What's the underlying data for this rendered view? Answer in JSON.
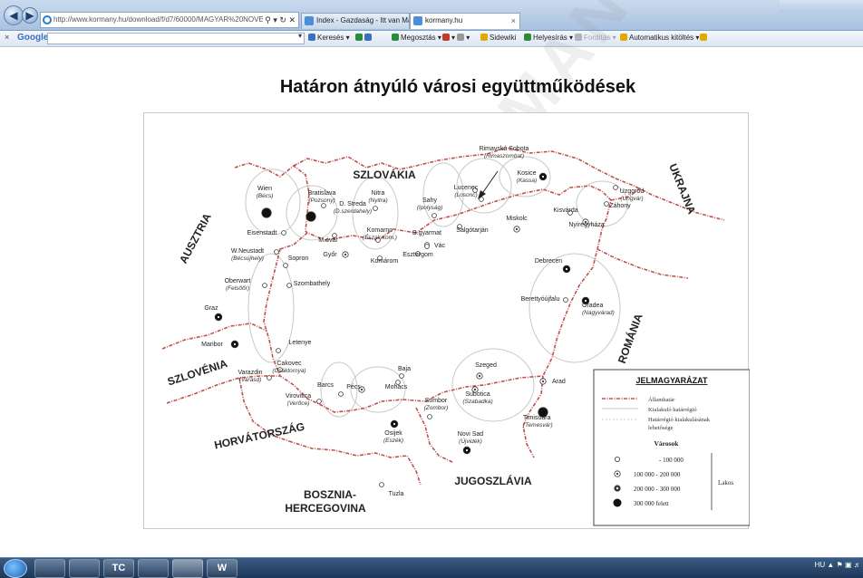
{
  "browser": {
    "address": "http://www.kormany.hu/download/f/d7/60000/MAGYAR%20NOVEKE",
    "tabs": [
      "Index - Gazdaság - Itt van Mat...",
      "kormany.hu"
    ],
    "tab_close": "×"
  },
  "googlebar": {
    "logo": "Google",
    "tools": [
      "Keresés ▾",
      "Megosztás ▾",
      "Sidewiki",
      "Helyesírás ▾",
      "Fordítás ▾",
      "Automatikus kitöltés ▾"
    ]
  },
  "page": {
    "title": "Határon átnyúló városi együttműködések",
    "watermark": "KORMANY"
  },
  "map": {
    "countries": [
      "SZLOVÁKIA",
      "UKRAJNA",
      "AUSZTRIA",
      "ROMÁNIA",
      "SZLOVÉNIA",
      "HORVÁTORSZÁG",
      "JUGOSZLÁVIA",
      "BOSZNIA-",
      "HERCEGOVINA"
    ],
    "cities": [
      {
        "name": "Wien",
        "alt": "(Bécs)",
        "size": 4
      },
      {
        "name": "Bratislava",
        "alt": "(Pozsony)",
        "size": 4
      },
      {
        "name": "D. Streda",
        "alt": "(D.szerdahely)",
        "size": 1
      },
      {
        "name": "Nitra",
        "alt": "(Nyitra)",
        "size": 1
      },
      {
        "name": "Sahy",
        "alt": "(Ipolyság)",
        "size": 1
      },
      {
        "name": "Lucenec",
        "alt": "(Losonc)",
        "size": 1
      },
      {
        "name": "Rimavská Sobota",
        "alt": "(Rimaszombat)",
        "size": 1
      },
      {
        "name": "Kosice",
        "alt": "(Kassa)",
        "size": 3
      },
      {
        "name": "Uzgorod",
        "alt": "(Ungvár)",
        "size": 1
      },
      {
        "name": "Záhony",
        "alt": "",
        "size": 1
      },
      {
        "name": "Kisvárda",
        "alt": "",
        "size": 1
      },
      {
        "name": "Nyíregyháza",
        "alt": "",
        "size": 2
      },
      {
        "name": "Miskolc",
        "alt": "",
        "size": 2
      },
      {
        "name": "Salgótarján",
        "alt": "",
        "size": 1
      },
      {
        "name": "B.gyarmat",
        "alt": "",
        "size": 1
      },
      {
        "name": "Vác",
        "alt": "",
        "size": 1
      },
      {
        "name": "Esztergom",
        "alt": "",
        "size": 1
      },
      {
        "name": "Komarno",
        "alt": "(Észak.kom.)",
        "size": 1
      },
      {
        "name": "Komárom",
        "alt": "",
        "size": 1
      },
      {
        "name": "M.óvár",
        "alt": "",
        "size": 1
      },
      {
        "name": "Győr",
        "alt": "",
        "size": 2
      },
      {
        "name": "Eisenstadt",
        "alt": "",
        "size": 1
      },
      {
        "name": "W.Neustadt",
        "alt": "(Bécsújhely)",
        "size": 1
      },
      {
        "name": "Sopron",
        "alt": "",
        "size": 1
      },
      {
        "name": "Oberwart",
        "alt": "(Felsőőr)",
        "size": 1
      },
      {
        "name": "Szombathely",
        "alt": "",
        "size": 1
      },
      {
        "name": "Graz",
        "alt": "",
        "size": 3
      },
      {
        "name": "Maribor",
        "alt": "",
        "size": 3
      },
      {
        "name": "Letenye",
        "alt": "",
        "size": 1
      },
      {
        "name": "Cakovec",
        "alt": "(Csáktornya)",
        "size": 1
      },
      {
        "name": "Varazdin",
        "alt": "(Varasd)",
        "size": 1
      },
      {
        "name": "Virovitica",
        "alt": "(Verőce)",
        "size": 1
      },
      {
        "name": "Barcs",
        "alt": "",
        "size": 1
      },
      {
        "name": "Pécs",
        "alt": "",
        "size": 2
      },
      {
        "name": "Mohács",
        "alt": "",
        "size": 1
      },
      {
        "name": "Baja",
        "alt": "",
        "size": 1
      },
      {
        "name": "Osijek",
        "alt": "(Eszék)",
        "size": 3
      },
      {
        "name": "Sombor",
        "alt": "(Zombor)",
        "size": 1
      },
      {
        "name": "Subotica",
        "alt": "(Szabadka)",
        "size": 2
      },
      {
        "name": "Szeged",
        "alt": "",
        "size": 2
      },
      {
        "name": "Novi Sad",
        "alt": "(Újvidék)",
        "size": 3
      },
      {
        "name": "Arad",
        "alt": "",
        "size": 2
      },
      {
        "name": "Timisoara",
        "alt": "(Temesvár)",
        "size": 4
      },
      {
        "name": "Debrecen",
        "alt": "",
        "size": 3
      },
      {
        "name": "Berettyóújfalu",
        "alt": "",
        "size": 1
      },
      {
        "name": "Oradea",
        "alt": "(Nagyvárad)",
        "size": 3
      },
      {
        "name": "Tuzla",
        "alt": "",
        "size": 1
      }
    ],
    "legend": {
      "title": "JELMAGYARÁZAT",
      "lines": [
        "Államhatár",
        "Kialakuló határrégió",
        "Határrégió kialakulásának",
        "lehetősége"
      ],
      "cities_title": "Városok",
      "sizes": [
        "- 100 000",
        "100 000 - 200 000",
        "200 000 - 300 000",
        "300 000 felett"
      ],
      "pop_label": "Lakos"
    },
    "colors": {
      "border": "#c0504d"
    }
  },
  "taskbar": {
    "apps": [
      "",
      "",
      "TC",
      "",
      "",
      "W"
    ],
    "tray": "HU"
  }
}
